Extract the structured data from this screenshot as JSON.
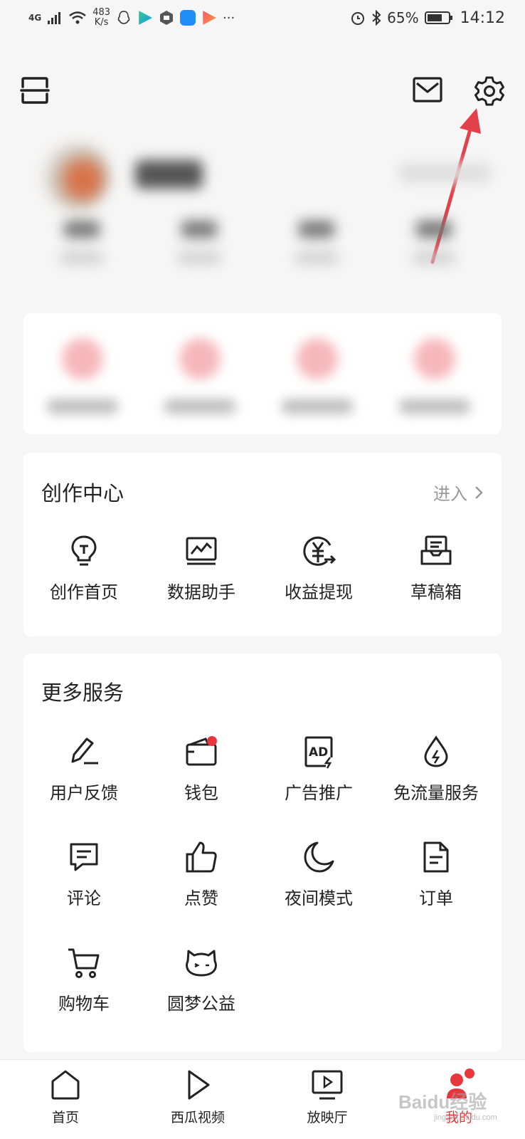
{
  "status_bar": {
    "network": "4G",
    "speed_value": "483",
    "speed_unit": "K/s",
    "battery": "65%",
    "time": "14:12",
    "more": "···"
  },
  "header": {
    "scan_icon": "scan-icon",
    "mail_icon": "mail-icon",
    "settings_icon": "gear-icon"
  },
  "creation_center": {
    "title": "创作中心",
    "enter_label": "进入",
    "items": [
      {
        "label": "创作首页",
        "icon": "lightbulb-icon"
      },
      {
        "label": "数据助手",
        "icon": "chart-monitor-icon"
      },
      {
        "label": "收益提现",
        "icon": "yuan-icon"
      },
      {
        "label": "草稿箱",
        "icon": "draft-box-icon"
      }
    ]
  },
  "more_services": {
    "title": "更多服务",
    "items": [
      {
        "label": "用户反馈",
        "icon": "pen-icon"
      },
      {
        "label": "钱包",
        "icon": "wallet-icon"
      },
      {
        "label": "广告推广",
        "icon": "ad-icon"
      },
      {
        "label": "免流量服务",
        "icon": "drop-icon"
      },
      {
        "label": "评论",
        "icon": "comment-icon"
      },
      {
        "label": "点赞",
        "icon": "thumbs-up-icon"
      },
      {
        "label": "夜间模式",
        "icon": "moon-icon"
      },
      {
        "label": "订单",
        "icon": "order-icon"
      },
      {
        "label": "购物车",
        "icon": "cart-icon"
      },
      {
        "label": "圆梦公益",
        "icon": "charity-icon"
      }
    ]
  },
  "bottom_nav": {
    "items": [
      {
        "label": "首页",
        "icon": "home-icon"
      },
      {
        "label": "西瓜视频",
        "icon": "play-icon"
      },
      {
        "label": "放映厅",
        "icon": "tv-icon"
      },
      {
        "label": "我的",
        "icon": "profile-icon"
      }
    ]
  },
  "colors": {
    "accent": "#e8363d",
    "arrow": "#e2414a",
    "text": "#222222",
    "muted": "#999999",
    "background": "#f6f6f6"
  },
  "watermark": {
    "main": "Baidu经验",
    "sub": "jingyan.baidu.com"
  }
}
